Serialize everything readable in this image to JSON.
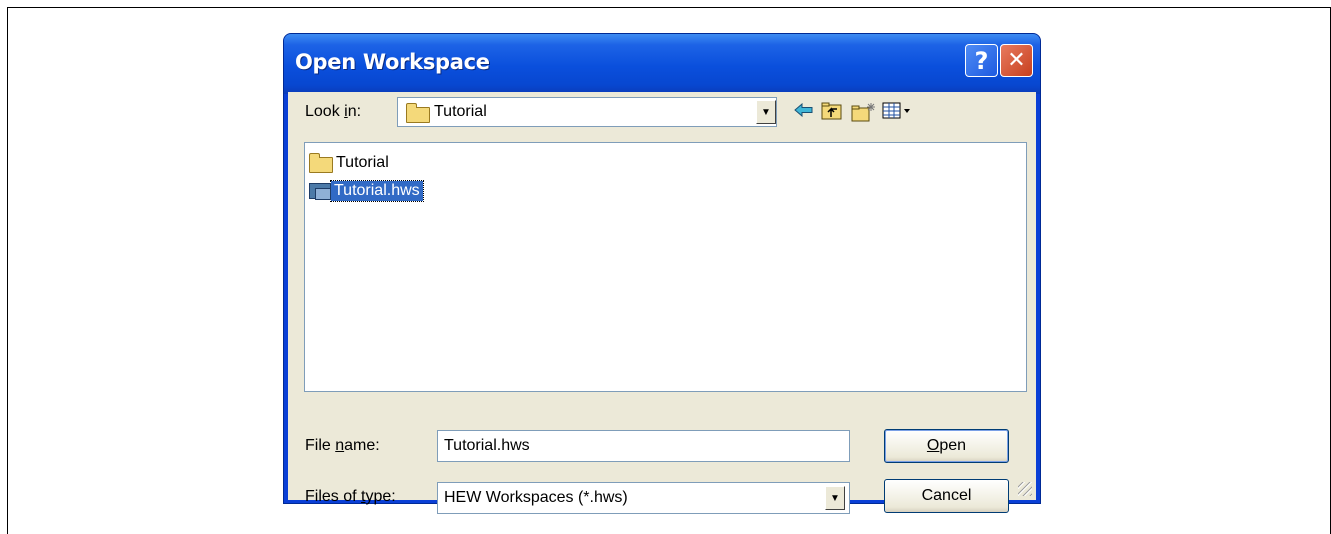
{
  "dialog": {
    "title": "Open Workspace",
    "help_glyph": "?",
    "close_glyph": "✕"
  },
  "lookin": {
    "label_pre": "Look ",
    "label_u": "i",
    "label_post": "n:",
    "value": "Tutorial"
  },
  "toolbar": {
    "icons": [
      "back-icon",
      "up-folder-icon",
      "new-folder-icon",
      "view-menu-icon"
    ]
  },
  "files": [
    {
      "name": "Tutorial",
      "icon": "folder-icon",
      "selected": false
    },
    {
      "name": "Tutorial.hws",
      "icon": "workspace-icon",
      "selected": true
    }
  ],
  "filename": {
    "label_pre": "File ",
    "label_u": "n",
    "label_post": "ame:",
    "value": "Tutorial.hws"
  },
  "filetype": {
    "label_pre": "Files of ",
    "label_u": "t",
    "label_post": "ype:",
    "value": "HEW Workspaces (*.hws)"
  },
  "buttons": {
    "open_u": "O",
    "open_rest": "pen",
    "cancel": "Cancel"
  },
  "colors": {
    "titlebar": "#0a4fdc",
    "client": "#ece9d8",
    "selection": "#316ac5"
  }
}
